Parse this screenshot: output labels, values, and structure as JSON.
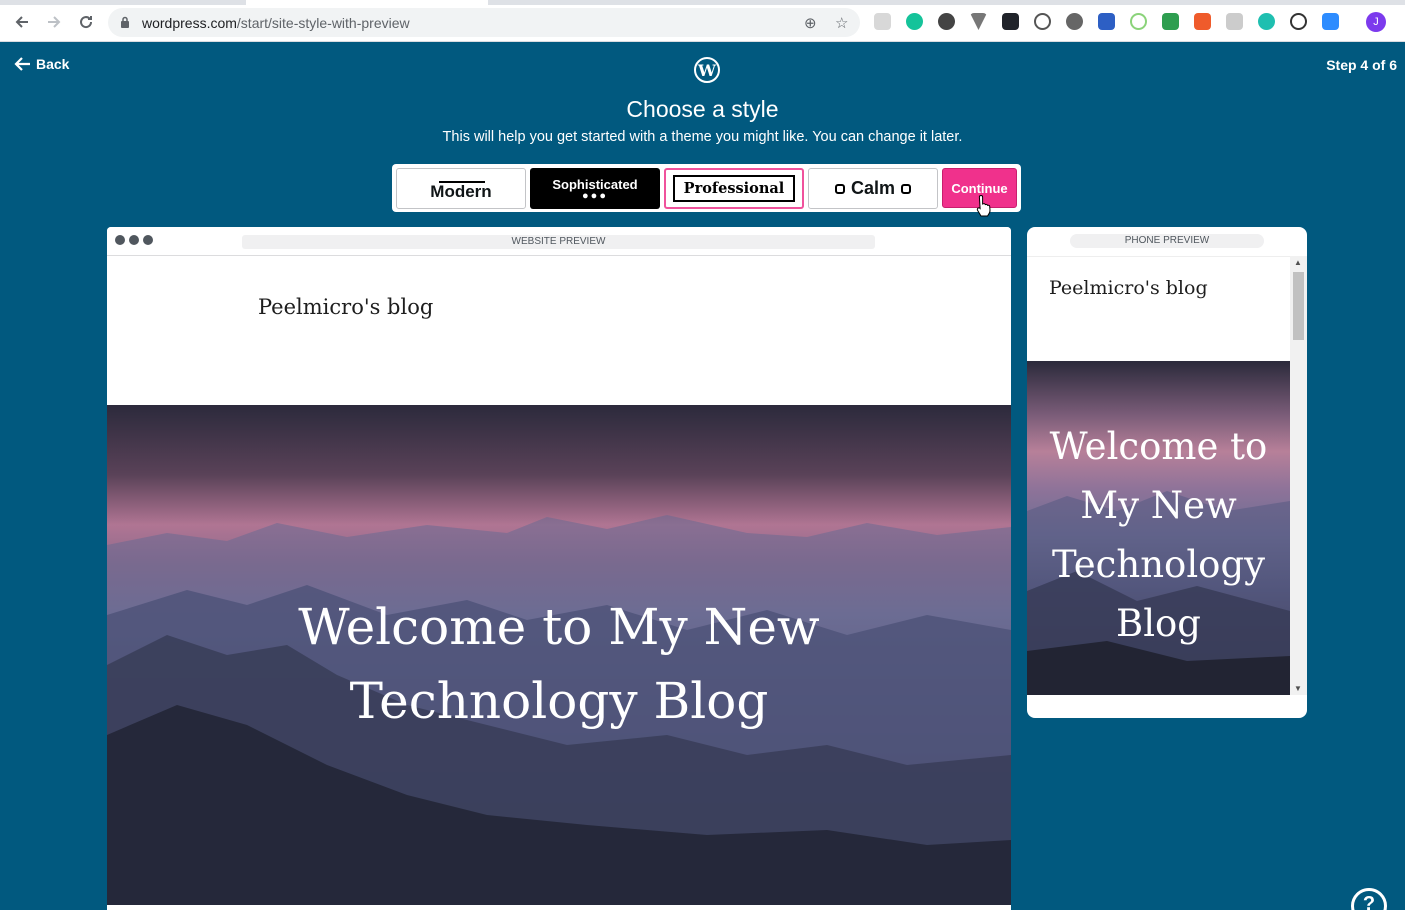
{
  "browser": {
    "url_host": "wordpress.com",
    "url_path": "/start/site-style-with-preview",
    "profile_initial": "J"
  },
  "header": {
    "back_label": "Back",
    "logo_letter": "W",
    "step": "Step 4 of 6",
    "title": "Choose a style",
    "subtitle": "This will help you get started with a theme you might like. You can change it later."
  },
  "styles": [
    {
      "label": "Modern"
    },
    {
      "label": "Sophisticated",
      "decoration": "●●●"
    },
    {
      "label": "Professional",
      "selected": true
    },
    {
      "label": "Calm"
    }
  ],
  "continue_label": "Continue",
  "website_preview": {
    "label": "WEBSITE PREVIEW",
    "site_title": "Peelmicro's blog",
    "hero_title_line1": "Welcome to My New",
    "hero_title_line2": "Technology Blog"
  },
  "phone_preview": {
    "label": "PHONE PREVIEW",
    "site_title": "Peelmicro's blog",
    "hero_title": "Welcome to My New Technology Blog"
  },
  "help_label": "?",
  "colors": {
    "page_bg": "#01597f",
    "accent_pink": "#f0318c",
    "selected_border": "#f0529c"
  }
}
